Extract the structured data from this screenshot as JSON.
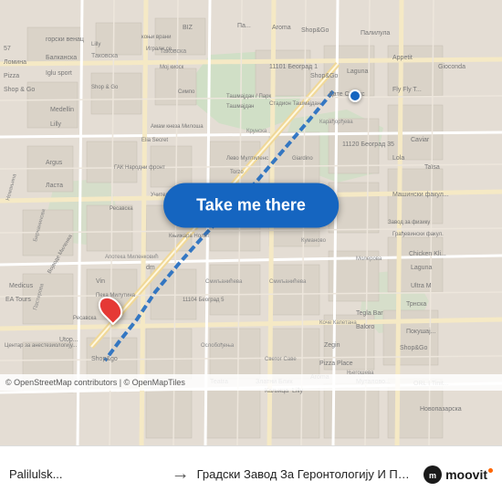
{
  "map": {
    "background_color": "#e8e0d8",
    "route_color": "#1565C0"
  },
  "button": {
    "label": "Take me there"
  },
  "markers": {
    "origin": {
      "label": "Origin marker"
    },
    "destination": {
      "label": "Destination marker"
    }
  },
  "copyright": {
    "text": "© OpenStreetMap contributors | © OpenMapTiles"
  },
  "bottom_bar": {
    "from_label": "",
    "from_name": "Palilulsk...",
    "to_name": "Градски Завод За Геронтологију И Па..."
  },
  "moovit": {
    "logo_text": "moovit"
  }
}
